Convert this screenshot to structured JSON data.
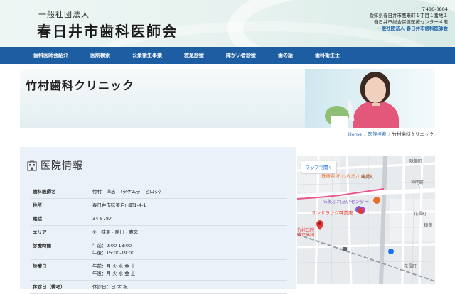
{
  "header": {
    "org_prefix": "一般社団法人",
    "org_name": "春日井市歯科医師会",
    "address": {
      "postal": "〒486-0804",
      "line1": "愛知県春日井市鷹来町１丁目１番地１",
      "line2": "春日井市総合保健医療センター４階",
      "brand": "一般社団法人 春日井市歯科医師会"
    }
  },
  "nav": {
    "items": [
      "歯科医師会紹介",
      "医院検索",
      "公衆衛生事業",
      "救急診療",
      "障がい者診療",
      "歯の話",
      "歯科衛生士"
    ]
  },
  "banner": {
    "title": "竹村歯科クリニック"
  },
  "breadcrumb": {
    "home": "Home",
    "search": "医院検索",
    "current": "竹村歯科クリニック",
    "separator": "/"
  },
  "info": {
    "heading": "医院情報",
    "rows": [
      {
        "key": "歯科医師名",
        "value": "竹村　洋志　（タケムラ　ヒロシ）"
      },
      {
        "key": "住所",
        "value": "春日井市味美白山町1-4-1"
      },
      {
        "key": "電話",
        "value": "34-5787"
      },
      {
        "key": "エリア",
        "value": "①　味美・勝川・鷹来"
      },
      {
        "key": "診療時間",
        "value": "午前：9:00-13:00\n午後：15:00-19:00"
      },
      {
        "key": "診療日",
        "value": "午前：月 火 水 金 土\n午後：月 火 水 金 土"
      },
      {
        "key": "休診日（備考）",
        "value": "休診日：日 木 祝"
      }
    ]
  },
  "map": {
    "open_button": "マップで開く",
    "labels": {
      "ajiyoshi_town": "味美町",
      "ajiyoshi_town_2": "味美町",
      "shinmei_town": "神明町",
      "supermarket": "鉄板台所 むらまさ 本店",
      "fureai_center": "味美ふれあいセンター",
      "drugstore": "サンドラッグ味美店",
      "kamigo": "花長町",
      "kanagawa": "知多",
      "ajiyoshi_ekimae": "味美",
      "clinic": "竹村口腔矯正歯科",
      "hanamachi": "花長町"
    }
  },
  "colors": {
    "nav_bg": "#1d5ea3",
    "brand_blue": "#1c5fa8",
    "info_bg": "#eaf1f8",
    "route_pink": "#e9558d"
  }
}
